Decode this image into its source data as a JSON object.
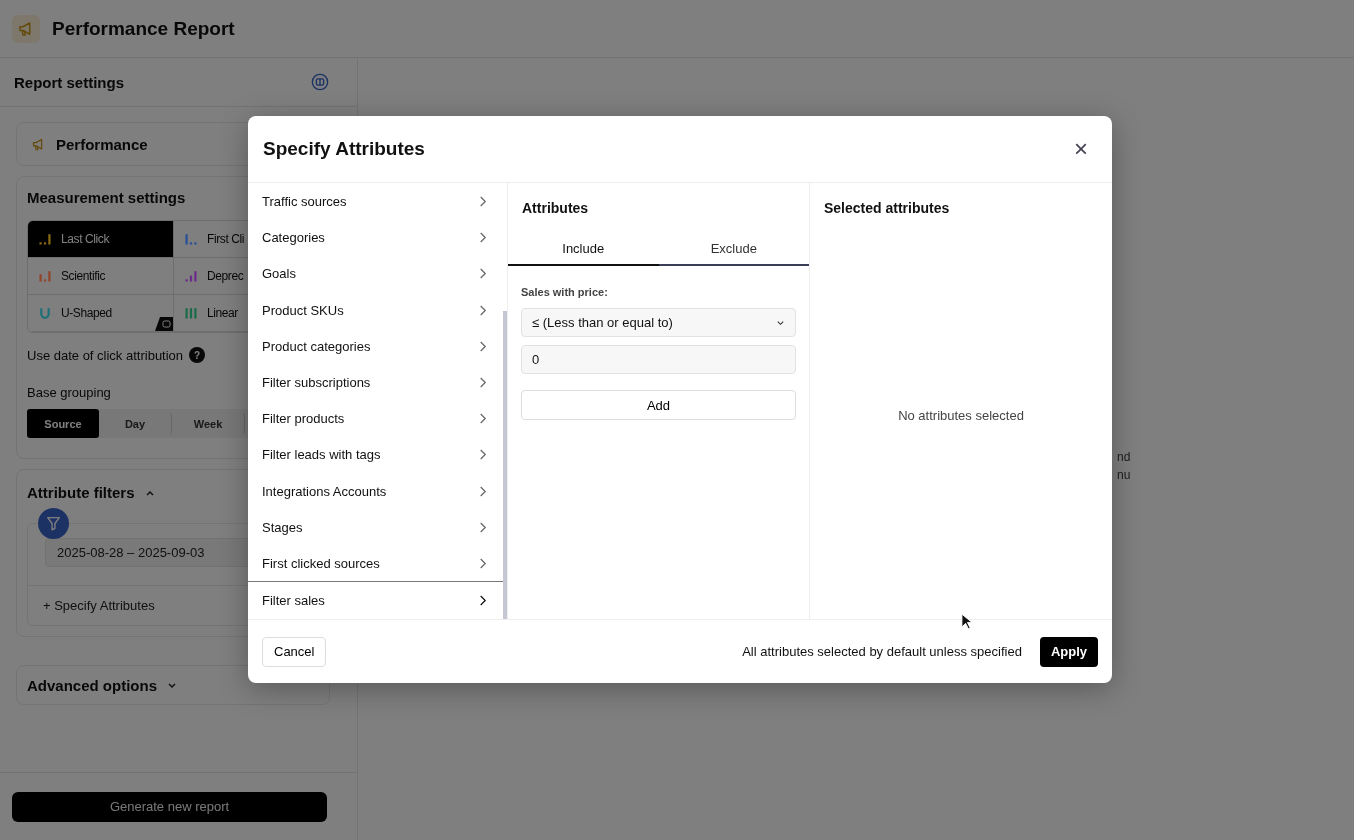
{
  "header": {
    "title": "Performance Report"
  },
  "sidebar": {
    "title": "Report settings",
    "report_type": "Performance",
    "measurement": {
      "title": "Measurement settings",
      "models": [
        {
          "label": "Last Click",
          "selected": true,
          "color": "#8a6a14"
        },
        {
          "label": "First Cli",
          "selected": false,
          "color": "#2a4f9a"
        },
        {
          "label": "Scientific",
          "selected": false,
          "color": "#93432a"
        },
        {
          "label": "Deprec",
          "selected": false,
          "color": "#6c2a8c"
        },
        {
          "label": "U-Shaped",
          "selected": false,
          "color": "#1f6f79"
        },
        {
          "label": "Linear",
          "selected": false,
          "color": "#1a6c49"
        }
      ],
      "click_date_label": "Use date of click attribution",
      "help": "?",
      "grouping_label": "Base grouping",
      "grouping": [
        {
          "label": "Source",
          "selected": true
        },
        {
          "label": "Day",
          "selected": false
        },
        {
          "label": "Week",
          "selected": false
        }
      ]
    },
    "filters": {
      "title": "Attribute filters",
      "expanded": true,
      "date_range": "2025-08-28 – 2025-09-03",
      "specify_link": "+ Specify Attributes"
    },
    "advanced": {
      "title": "Advanced options",
      "expanded": false
    },
    "generate_button": "Generate new report"
  },
  "main": {
    "background_text": [
      "nd",
      "nu"
    ]
  },
  "modal": {
    "title": "Specify Attributes",
    "close": "×",
    "categories": [
      {
        "label": "Traffic sources",
        "selected": false
      },
      {
        "label": "Categories",
        "selected": false
      },
      {
        "label": "Goals",
        "selected": false
      },
      {
        "label": "Product SKUs",
        "selected": false
      },
      {
        "label": "Product categories",
        "selected": false
      },
      {
        "label": "Filter subscriptions",
        "selected": false
      },
      {
        "label": "Filter products",
        "selected": false
      },
      {
        "label": "Filter leads with tags",
        "selected": false
      },
      {
        "label": "Integrations Accounts",
        "selected": false
      },
      {
        "label": "Stages",
        "selected": false
      },
      {
        "label": "First clicked sources",
        "selected": false
      },
      {
        "label": "Filter sales",
        "selected": true
      }
    ],
    "attributes": {
      "title": "Attributes",
      "tabs": [
        {
          "label": "Include",
          "selected": true
        },
        {
          "label": "Exclude",
          "selected": false
        }
      ],
      "field_label": "Sales with price:",
      "operator": "≤ (Less than or equal to)",
      "value": "0",
      "add_button": "Add"
    },
    "selected": {
      "title": "Selected attributes",
      "empty": "No attributes selected"
    },
    "cancel": "Cancel",
    "hint": "All attributes selected by default unless specified",
    "apply": "Apply"
  }
}
